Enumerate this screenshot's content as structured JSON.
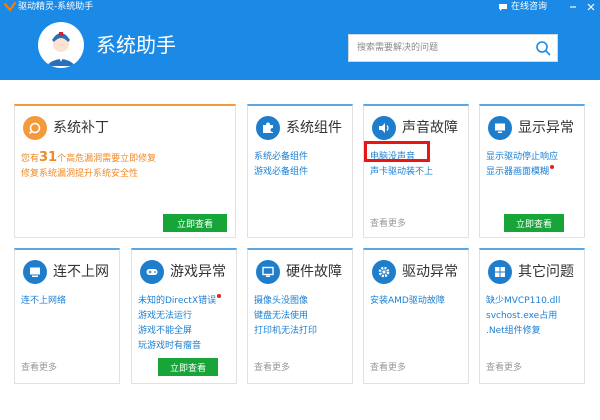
{
  "window": {
    "title": "驱动精灵-系统助手",
    "consult_label": "在线咨询"
  },
  "header": {
    "title": "系统助手",
    "search_placeholder": "搜索需要解决的问题"
  },
  "cards": {
    "patch": {
      "title": "系统补丁",
      "desc_prefix": "您有",
      "desc_count": "31",
      "desc_suffix": "个高危漏洞需要立即修复",
      "desc_line2": "修复系统漏洞提升系统安全性",
      "button": "立即查看"
    },
    "components": {
      "title": "系统组件",
      "links": [
        "系统必备组件",
        "游戏必备组件"
      ]
    },
    "sound": {
      "title": "声音故障",
      "links": [
        "电脑没声音",
        "声卡驱动装不上"
      ],
      "more": "查看更多"
    },
    "display": {
      "title": "显示异常",
      "links": [
        "显示驱动停止响应",
        "显示器画面模糊"
      ],
      "button": "立即查看"
    },
    "network": {
      "title": "连不上网",
      "links": [
        "连不上网络"
      ],
      "more": "查看更多"
    },
    "game": {
      "title": "游戏异常",
      "links": [
        "未知的DirectX错误",
        "游戏无法运行",
        "游戏不能全屏",
        "玩游戏时有瘤音"
      ],
      "button": "立即查看"
    },
    "hardware": {
      "title": "硬件故障",
      "links": [
        "摄像头没图像",
        "键盘无法使用",
        "打印机无法打印"
      ],
      "more": "查看更多"
    },
    "driver": {
      "title": "驱动异常",
      "links": [
        "安装AMD驱动故障"
      ],
      "more": "查看更多"
    },
    "other": {
      "title": "其它问题",
      "links": [
        "缺少MVCP110.dll",
        "svchost.exe占用",
        ".Net组件修复"
      ],
      "more": "查看更多"
    }
  },
  "colors": {
    "header_bg": "#1a8ae6",
    "accent_orange": "#f59a3c",
    "link_blue": "#1a7fd4",
    "button_green": "#17a53a",
    "highlight_red": "#e81515"
  }
}
